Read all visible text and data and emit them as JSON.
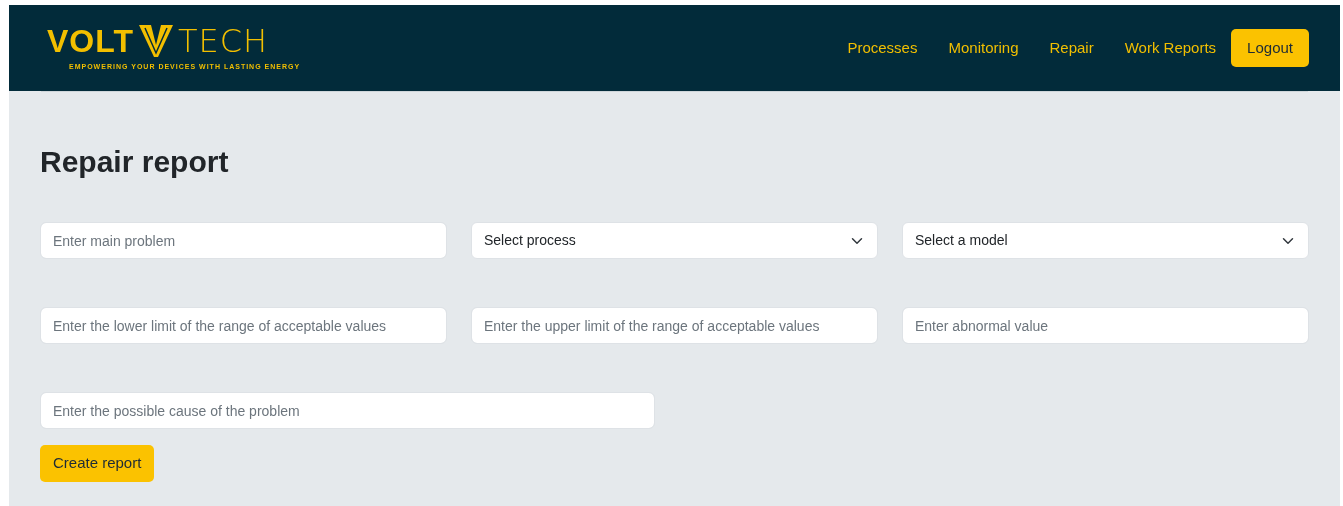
{
  "brand": {
    "word_left": "VOLT",
    "word_right": "TECH",
    "tagline": "EMPOWERING YOUR DEVICES WITH LASTING ENERGY"
  },
  "nav": [
    {
      "label": "Processes",
      "kind": "link"
    },
    {
      "label": "Monitoring",
      "kind": "link"
    },
    {
      "label": "Repair",
      "kind": "link"
    },
    {
      "label": "Work Reports",
      "kind": "link"
    },
    {
      "label": "Logout",
      "kind": "button"
    }
  ],
  "title": "Repair report",
  "form_rows": [
    [
      {
        "kind": "input",
        "placeholder": "Enter main problem"
      },
      {
        "kind": "select",
        "value": "Select process"
      },
      {
        "kind": "select",
        "value": "Select a model"
      }
    ],
    [
      {
        "kind": "input",
        "placeholder": "Enter the lower limit of the range of acceptable values"
      },
      {
        "kind": "input",
        "placeholder": "Enter the upper limit of the range of acceptable values"
      },
      {
        "kind": "input",
        "placeholder": "Enter abnormal value"
      }
    ],
    [
      {
        "kind": "input",
        "placeholder": "Enter the possible cause of the problem"
      }
    ]
  ],
  "submit": "Create report"
}
